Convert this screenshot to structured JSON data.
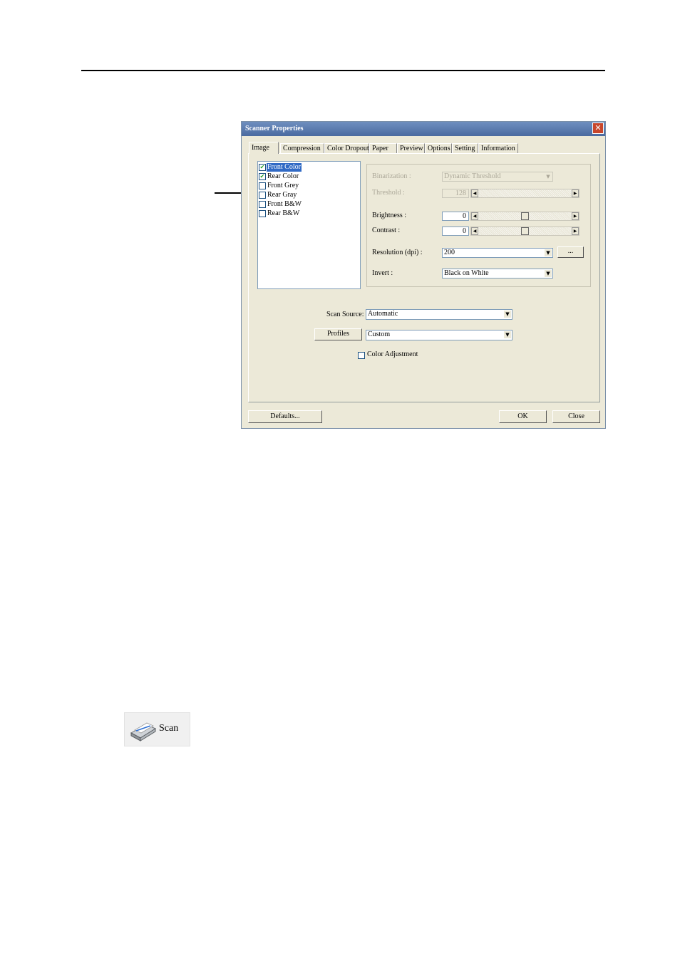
{
  "dialog": {
    "title": "Scanner Properties",
    "close_glyph": "✕",
    "tabs": [
      "Image",
      "Compression",
      "Color Dropout",
      "Paper",
      "Preview",
      "Options",
      "Setting",
      "Information"
    ],
    "active_tab": "Image",
    "image_list": [
      {
        "label": "Front Color",
        "checked": true,
        "selected": true
      },
      {
        "label": "Rear Color",
        "checked": true,
        "selected": false
      },
      {
        "label": "Front Grey",
        "checked": false,
        "selected": false
      },
      {
        "label": "Rear Gray",
        "checked": false,
        "selected": false
      },
      {
        "label": "Front B&W",
        "checked": false,
        "selected": false
      },
      {
        "label": "Rear B&W",
        "checked": false,
        "selected": false
      }
    ],
    "check_glyph": "✔",
    "settings": {
      "binarization_label": "Binarization :",
      "binarization_value": "Dynamic Threshold",
      "threshold_label": "Threshold :",
      "threshold_value": "128",
      "brightness_label": "Brightness :",
      "brightness_value": "0",
      "contrast_label": "Contrast  :",
      "contrast_value": "0",
      "resolution_label": "Resolution (dpi) :",
      "resolution_value": "200",
      "resolution_more": "...",
      "invert_label": "Invert :",
      "invert_value": "Black on White"
    },
    "scan_source_label": "Scan Source:",
    "scan_source_value": "Automatic",
    "profiles_button": "Profiles",
    "profiles_value": "Custom",
    "color_adjustment_label": "Color Adjustment",
    "color_adjustment_checked": false,
    "defaults_button": "Defaults...",
    "ok_button": "OK",
    "close_button": "Close",
    "arrow_down": "▼",
    "arrow_left": "◀",
    "arrow_right": "▶",
    "colors": {
      "titlebar": "#5a7ab0",
      "selection": "#316ac5",
      "close": "#c8462b",
      "face": "#ece9d8"
    }
  },
  "scan_button": {
    "label": "Scan",
    "icon": "scanner-icon"
  }
}
